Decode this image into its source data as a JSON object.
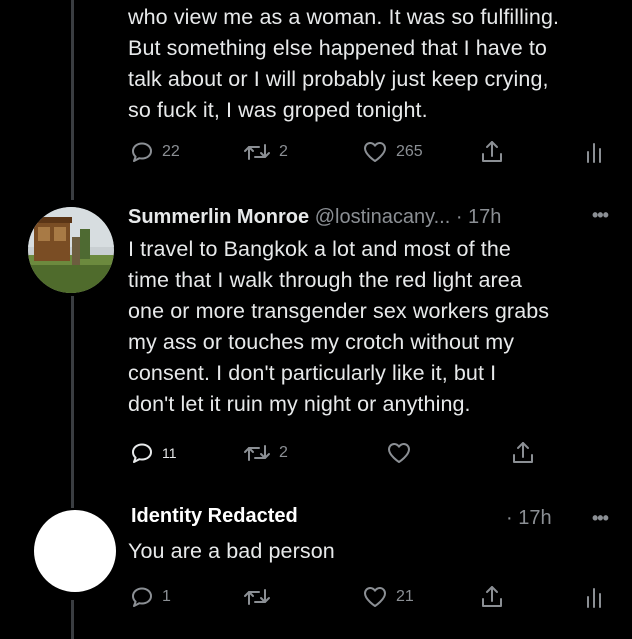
{
  "tweet1": {
    "lines": [
      "who view me as a woman. It was so fulfilling.",
      "But something else happened that I have to",
      "talk about or I will probably just keep crying,",
      "so fuck it, I was groped tonight."
    ],
    "replies": "22",
    "retweets": "2",
    "likes": "265"
  },
  "tweet2": {
    "name": "Summerlin Monroe",
    "handle": "@lostinacany...",
    "time": "· 17h",
    "lines": [
      "I travel to Bangkok a lot and most of the",
      "time that I walk through the red light area",
      "one or more transgender sex workers grabs",
      "my ass or touches my crotch without my",
      "consent. I don't particularly like it, but I",
      "don't let it ruin my night or anything."
    ],
    "replies": "11",
    "retweets": "2",
    "likes": ""
  },
  "tweet3": {
    "name": "Identity Redacted",
    "time": "· 17h",
    "lines": [
      "You are a bad person"
    ],
    "replies": "1",
    "retweets": "",
    "likes": "21"
  },
  "more_glyph": "•••",
  "icons": [
    "reply-icon",
    "retweet-icon",
    "like-icon",
    "share-icon",
    "analytics-icon",
    "more-icon"
  ],
  "colors": {
    "background": "#000000",
    "text": "#e7e9ea",
    "muted": "#8b8f94",
    "thread_line": "#3a3d41"
  }
}
